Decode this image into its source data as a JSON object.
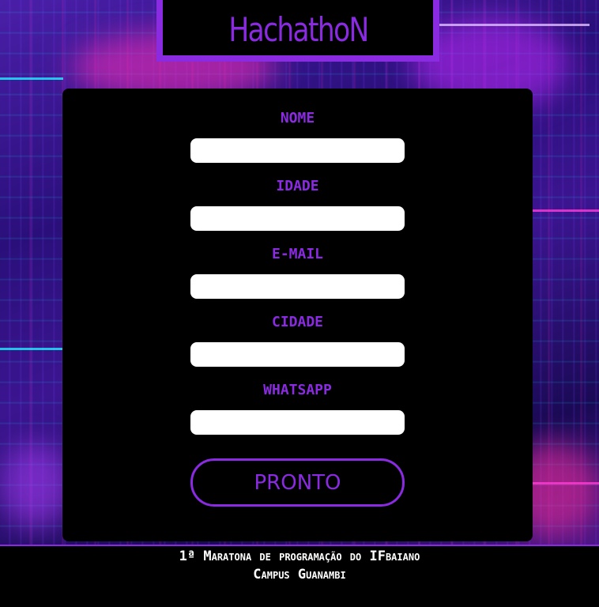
{
  "header": {
    "title": "HachathoN"
  },
  "form": {
    "fields": [
      {
        "label": "NOME",
        "value": ""
      },
      {
        "label": "IDADE",
        "value": ""
      },
      {
        "label": "E-MAIL",
        "value": ""
      },
      {
        "label": "CIDADE",
        "value": ""
      },
      {
        "label": "WHATSAPP",
        "value": ""
      }
    ],
    "submit_label": "PRONTO"
  },
  "footer": {
    "line1": "1ª Maratona de programação do IFbaiano",
    "line2": "Campus Guanambi"
  },
  "colors": {
    "accent": "#8a2be2",
    "panel": "#000000",
    "input": "#ffffff"
  }
}
